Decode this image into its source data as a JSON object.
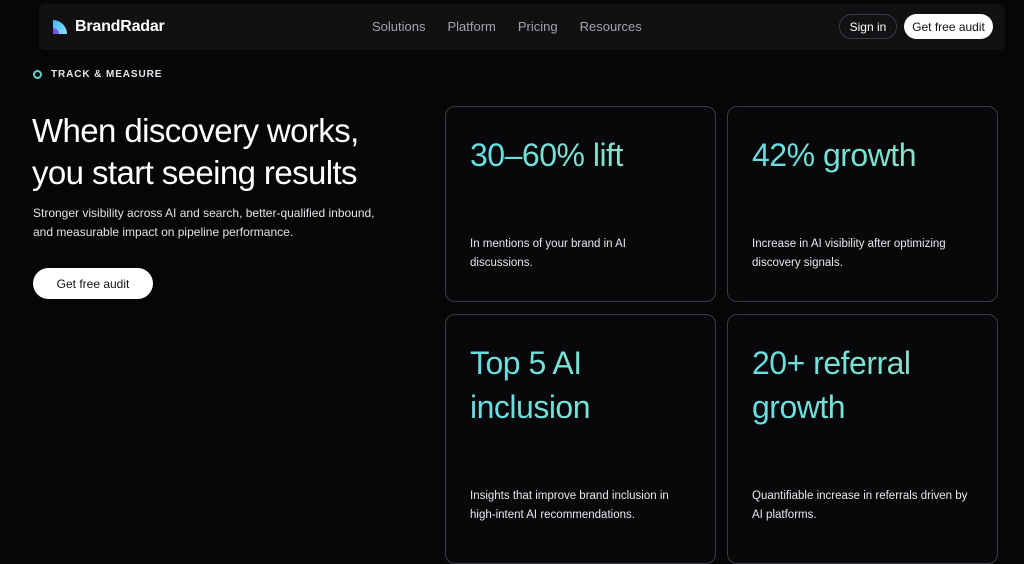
{
  "nav": {
    "brand": "BrandRadar",
    "links": [
      "Solutions",
      "Platform",
      "Pricing",
      "Resources"
    ],
    "signin_label": "Sign in",
    "cta_label": "Get free audit"
  },
  "hero": {
    "eyebrow": "TRACK & MEASURE",
    "headline_line1": "When discovery works,",
    "headline_line2": "you start seeing results",
    "subtext_line1": "Stronger visibility across AI and search, better-qualified inbound,",
    "subtext_line2": "and measurable impact on pipeline performance.",
    "cta_label": "Get free audit"
  },
  "stats": [
    {
      "stat_line1": "30–60% lift",
      "stat_line2": "",
      "desc_line1": "In mentions of your brand in AI",
      "desc_line2": "discussions."
    },
    {
      "stat_line1": "42% growth",
      "stat_line2": "",
      "desc_line1": "Increase in AI visibility after optimizing",
      "desc_line2": "discovery signals."
    },
    {
      "stat_line1": "Top 5 AI",
      "stat_line2": "inclusion",
      "desc_line1": "Insights that improve brand inclusion in",
      "desc_line2": "high-intent AI recommendations."
    },
    {
      "stat_line1": "20+ referral",
      "stat_line2": "growth",
      "desc_line1": "Quantifiable increase in referrals driven by",
      "desc_line2": "AI platforms."
    }
  ],
  "colors": {
    "background": "#060608",
    "accent_teal": "#67dde3",
    "accent_sage": "#b6d9b2",
    "card_border": "#3a3a40"
  },
  "icons": {
    "brand_logo": "brandradar-logo-icon",
    "eyebrow_marker": "ring-dot-icon"
  }
}
